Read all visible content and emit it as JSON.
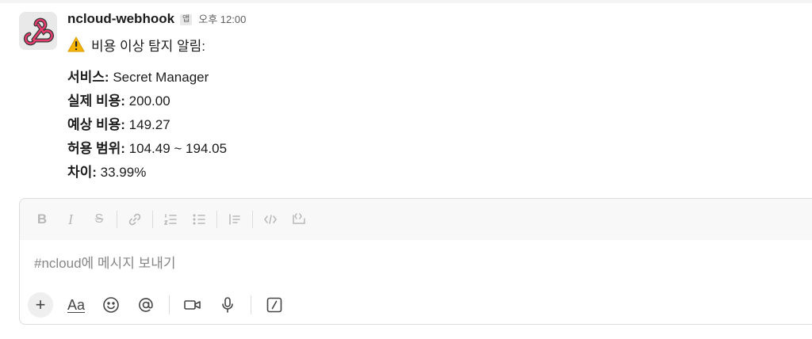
{
  "message": {
    "sender": "ncloud-webhook",
    "app_badge": "앱",
    "time": "오후 12:00",
    "alert_title": "비용 이상 탐지 알림:",
    "fields": [
      {
        "label": "서비스:",
        "value": " Secret Manager"
      },
      {
        "label": "실제 비용:",
        "value": " 200.00"
      },
      {
        "label": "예상 비용:",
        "value": " 149.27"
      },
      {
        "label": "허용 범위:",
        "value": " 104.49 ~ 194.05"
      },
      {
        "label": "차이:",
        "value": " 33.99%"
      }
    ]
  },
  "composer": {
    "placeholder": "#ncloud에 메시지 보내기",
    "format_buttons": [
      "bold-icon",
      "italic-icon",
      "strikethrough-icon",
      "link-icon",
      "ordered-list-icon",
      "bullet-list-icon",
      "blockquote-icon",
      "code-icon",
      "code-block-icon"
    ],
    "aa_label": "Aa"
  },
  "colors": {
    "warning": "#f5b400",
    "webhook_pink": "#e63c6d",
    "muted": "#616061"
  }
}
